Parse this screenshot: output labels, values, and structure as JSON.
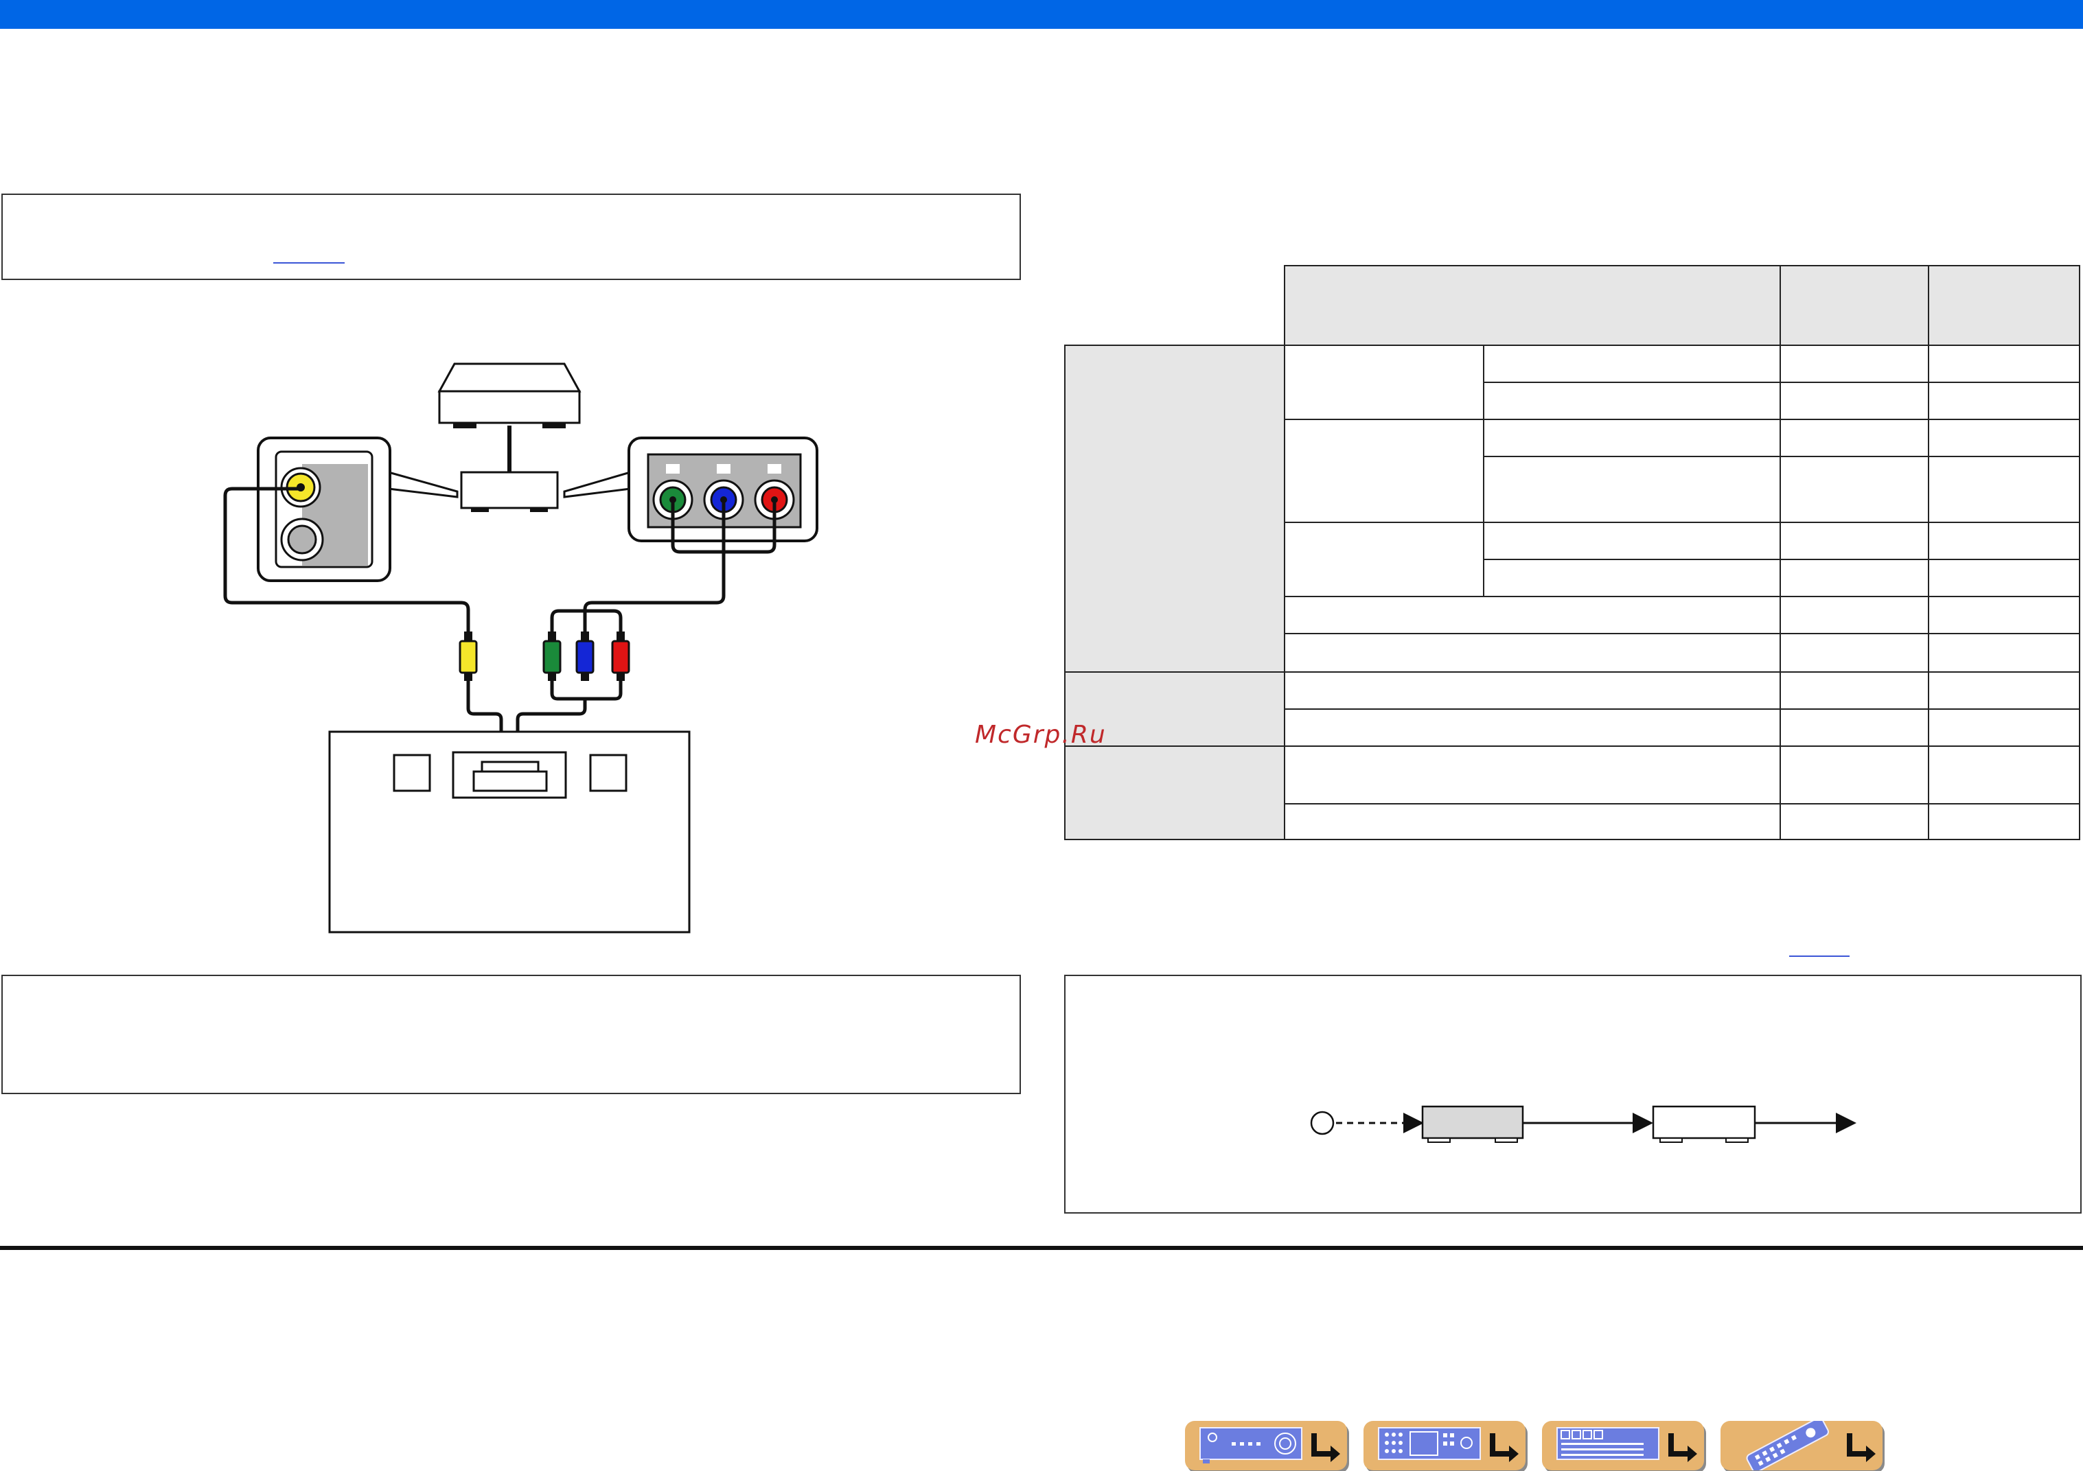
{
  "colors": {
    "header_bar": "#0066e6",
    "link": "#3b56d6",
    "watermark": "#c0282a",
    "cable_yellow": "#f5e62a",
    "cable_green": "#1a8a3a",
    "cable_blue": "#1426d6",
    "cable_red": "#e01414",
    "nav_button": "#e7b46f",
    "table_shade": "#e6e6e6"
  },
  "watermark": "McGrp.Ru",
  "nav": {
    "buttons": [
      {
        "icon": "receiver-front-icon"
      },
      {
        "icon": "receiver-rear-icon"
      },
      {
        "icon": "display-panel-icon"
      },
      {
        "icon": "remote-control-icon"
      }
    ],
    "arrow_icon": "return-arrow-icon"
  }
}
